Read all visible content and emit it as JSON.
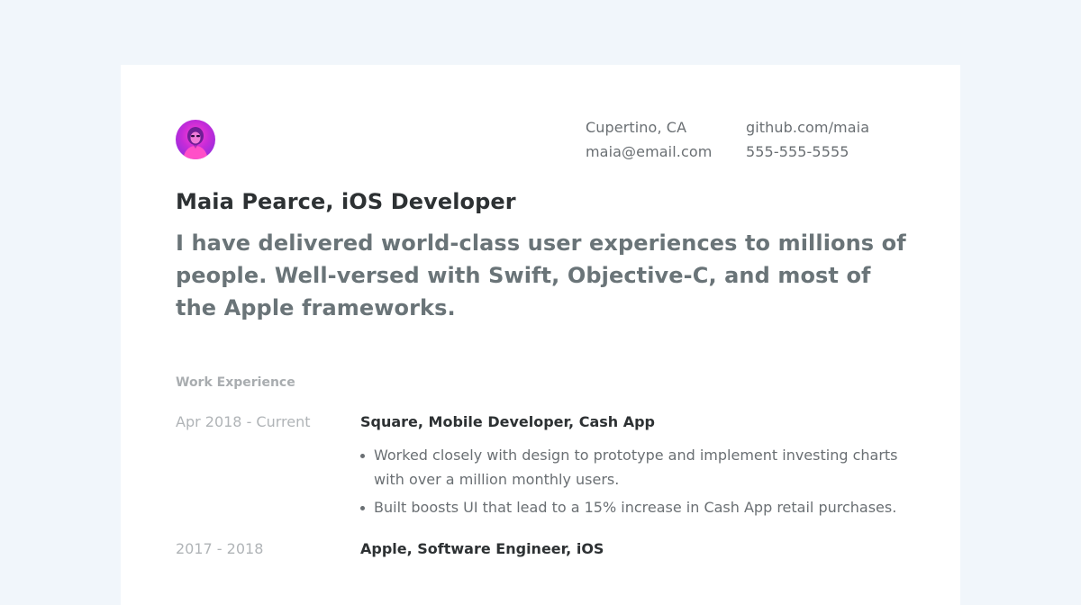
{
  "profile": {
    "name_title": "Maia Pearce, iOS Developer",
    "summary": "I have delivered world-class user experiences to millions of people. Well-versed with Swift, Objective-C, and most of the Apple frameworks."
  },
  "contact": {
    "location": "Cupertino, CA",
    "email": "maia@email.com",
    "github": "github.com/maia",
    "phone": "555-555-5555"
  },
  "sections": {
    "work_title": "Work Experience"
  },
  "jobs": [
    {
      "dates": "Apr 2018 - Current",
      "title": "Square, Mobile Developer, Cash App",
      "bullets": [
        "Worked closely with design to prototype and implement investing charts with over a million monthly users.",
        "Built boosts UI that lead to a 15% increase in Cash App retail purchases."
      ]
    },
    {
      "dates": "2017 - 2018",
      "title": "Apple, Software Engineer, iOS"
    }
  ],
  "colors": {
    "page_background": "#f1f6fb",
    "card_background": "#ffffff",
    "avatar_accent": "#c52bd8"
  },
  "icons": {
    "avatar": "user-photo-avatar"
  }
}
